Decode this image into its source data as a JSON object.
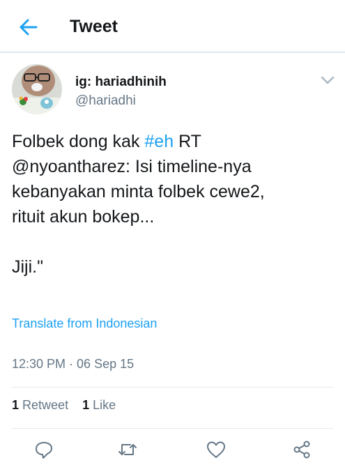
{
  "header": {
    "title": "Tweet",
    "back_icon": "arrow-left-icon",
    "accent": "#1da1f2"
  },
  "author": {
    "display_name": "ig: hariadhinih",
    "username": "@hariadhi"
  },
  "tweet": {
    "text_before": "Folbek dong kak ",
    "hashtag": "#eh",
    "text_after": " RT\n@nyoantharez: Isi timeline-nya\nkebanyakan minta folbek cewe2,\nrituit akun bokep...\n\nJiji.\"",
    "translate_label": "Translate from Indonesian",
    "timestamp": "12:30 PM · 06 Sep 15"
  },
  "stats": {
    "retweets_count": "1",
    "retweets_label": "Retweet",
    "likes_count": "1",
    "likes_label": "Like"
  },
  "actions": [
    "reply-icon",
    "retweet-icon",
    "like-icon",
    "share-icon"
  ],
  "colors": {
    "text": "#14171a",
    "secondary": "#657786",
    "link": "#1da1f2",
    "divider": "#e1e8ed"
  }
}
